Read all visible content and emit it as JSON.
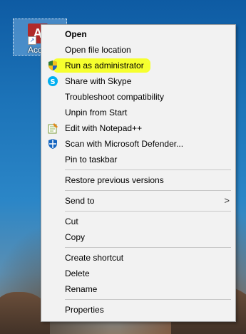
{
  "desktop": {
    "shortcut": {
      "icon_name": "access-app-icon",
      "label": "Acc"
    }
  },
  "context_menu": {
    "items": [
      {
        "label": "Open",
        "bold": true,
        "icon": ""
      },
      {
        "label": "Open file location",
        "icon": ""
      },
      {
        "label": "Run as administrator",
        "icon": "uac-shield-icon",
        "highlighted": true
      },
      {
        "label": "Share with Skype",
        "icon": "skype-icon"
      },
      {
        "label": "Troubleshoot compatibility",
        "icon": ""
      },
      {
        "label": "Unpin from Start",
        "icon": ""
      },
      {
        "label": "Edit with Notepad++",
        "icon": "notepadpp-icon"
      },
      {
        "label": "Scan with Microsoft Defender...",
        "icon": "defender-icon"
      },
      {
        "label": "Pin to taskbar",
        "icon": ""
      },
      {
        "label": "Restore previous versions",
        "icon": ""
      },
      {
        "label": "Send to",
        "icon": "",
        "submenu_arrow": ">"
      },
      {
        "label": "Cut",
        "icon": ""
      },
      {
        "label": "Copy",
        "icon": ""
      },
      {
        "label": "Create shortcut",
        "icon": ""
      },
      {
        "label": "Delete",
        "icon": ""
      },
      {
        "label": "Rename",
        "icon": ""
      },
      {
        "label": "Properties",
        "icon": ""
      }
    ]
  },
  "colors": {
    "highlight": "#f6ff2e",
    "menu_background": "#f2f2f2",
    "separator": "#c8c8c8"
  }
}
